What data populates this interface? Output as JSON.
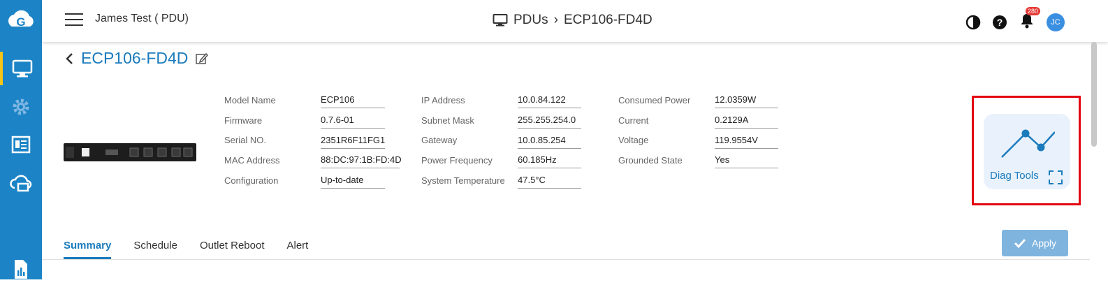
{
  "header": {
    "site_name": "James Test ( PDU)",
    "breadcrumb_parent": "PDUs",
    "breadcrumb_sep": "›",
    "breadcrumb_current": "ECP106-FD4D",
    "notification_count": "280",
    "avatar_initials": "JC"
  },
  "device": {
    "title": "ECP106-FD4D",
    "col1": [
      {
        "label": "Model Name",
        "value": "ECP106"
      },
      {
        "label": "Firmware",
        "value": "0.7.6-01"
      },
      {
        "label": "Serial NO.",
        "value": "2351R6F11FG1"
      },
      {
        "label": "MAC Address",
        "value": "88:DC:97:1B:FD:4D"
      },
      {
        "label": "Configuration",
        "value": "Up-to-date"
      }
    ],
    "col2": [
      {
        "label": "IP Address",
        "value": "10.0.84.122"
      },
      {
        "label": "Subnet Mask",
        "value": "255.255.254.0"
      },
      {
        "label": "Gateway",
        "value": "10.0.85.254"
      },
      {
        "label": "Power Frequency",
        "value": "60.185Hz"
      },
      {
        "label": "System Temperature",
        "value": "47.5°C"
      }
    ],
    "col3": [
      {
        "label": "Consumed Power",
        "value": "12.0359W"
      },
      {
        "label": "Current",
        "value": "0.2129A"
      },
      {
        "label": "Voltage",
        "value": "119.9554V"
      },
      {
        "label": "Grounded State",
        "value": "Yes"
      }
    ]
  },
  "diag": {
    "label": "Diag Tools"
  },
  "tabs": [
    {
      "label": "Summary",
      "active": true
    },
    {
      "label": "Schedule"
    },
    {
      "label": "Outlet Reboot"
    },
    {
      "label": "Alert"
    }
  ],
  "apply_label": "Apply",
  "colors": {
    "sidebar": "#1c84c6",
    "accent": "#1b7bbd",
    "highlight": "#e3000f"
  }
}
